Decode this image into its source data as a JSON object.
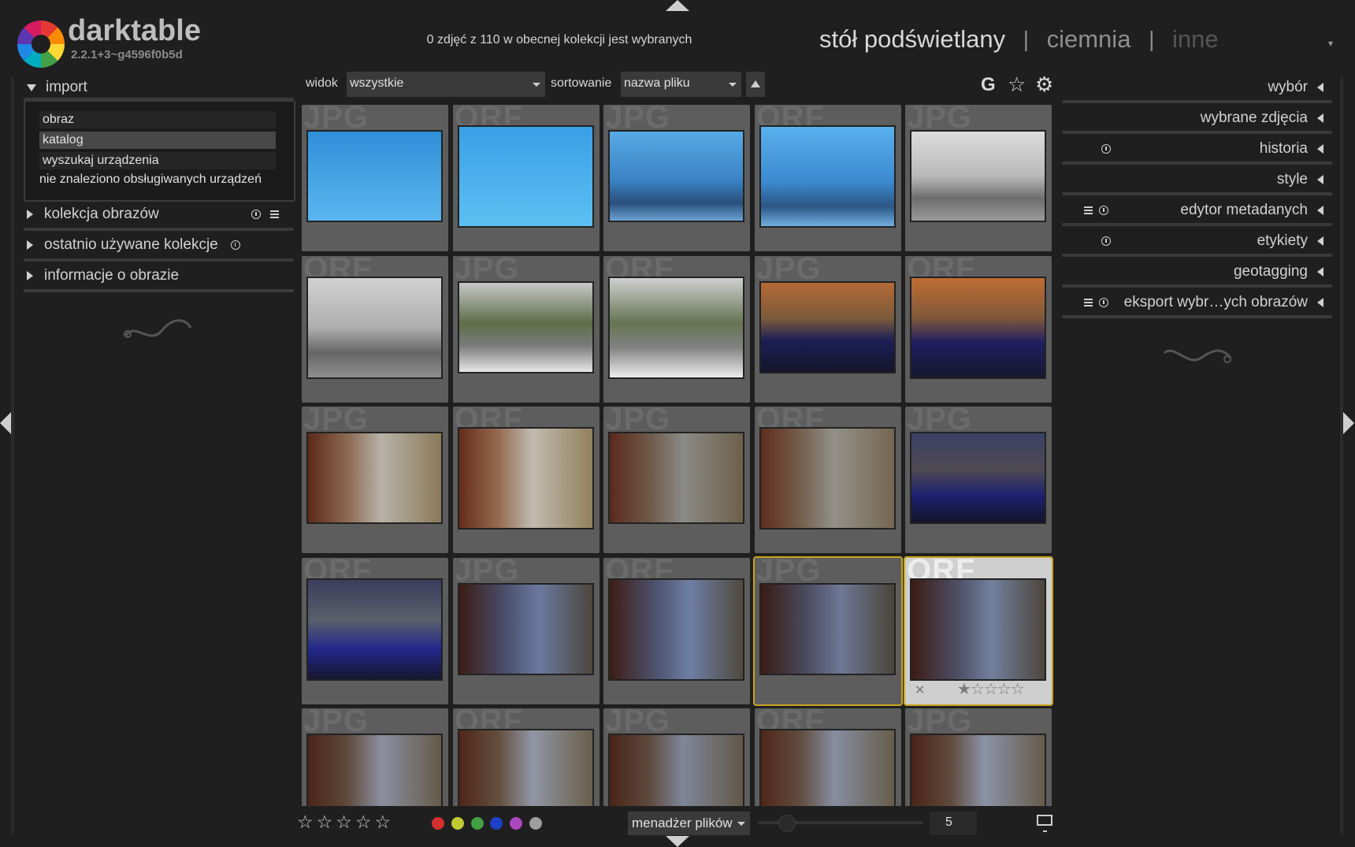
{
  "app": {
    "name": "darktable",
    "version": "2.2.1+3~g4596f0b5d"
  },
  "header": {
    "selection_status": "0 zdjęć z 110 w obecnej kolekcji jest wybranych",
    "views": {
      "active": "stół podświetlany",
      "darkroom": "ciemnia",
      "other": "inne",
      "sep": "|"
    }
  },
  "left_panel": {
    "import": {
      "label": "import",
      "items": [
        "obraz",
        "katalog",
        "wyszukaj urządzenia",
        "nie znaleziono obsługiwanych urządzeń"
      ]
    },
    "modules": [
      "kolekcja obrazów",
      "ostatnio używane kolekcje",
      "informacje o obrazie"
    ]
  },
  "toolbar": {
    "view_label": "widok",
    "view_value": "wszystkie",
    "sort_label": "sortowanie",
    "sort_value": "nazwa pliku",
    "grouping_label": "G",
    "star_glyph": "☆",
    "gear_glyph": "⚙"
  },
  "grid": {
    "thumbnails": [
      {
        "ext": "JPG",
        "palette": "blue-tower-a"
      },
      {
        "ext": "ORF",
        "palette": "blue-tower-b"
      },
      {
        "ext": "JPG",
        "palette": "blue-building-a"
      },
      {
        "ext": "ORF",
        "palette": "blue-building-b"
      },
      {
        "ext": "JPG",
        "palette": "flags-a"
      },
      {
        "ext": "ORF",
        "palette": "flags-b"
      },
      {
        "ext": "JPG",
        "palette": "atrium-a"
      },
      {
        "ext": "ORF",
        "palette": "atrium-b"
      },
      {
        "ext": "JPG",
        "palette": "booth-a"
      },
      {
        "ext": "ORF",
        "palette": "booth-b"
      },
      {
        "ext": "JPG",
        "palette": "hall-a"
      },
      {
        "ext": "ORF",
        "palette": "hall-b"
      },
      {
        "ext": "JPG",
        "palette": "hall-c"
      },
      {
        "ext": "ORF",
        "palette": "hall-d"
      },
      {
        "ext": "JPG",
        "palette": "booth-c"
      },
      {
        "ext": "ORF",
        "palette": "booth-d"
      },
      {
        "ext": "JPG",
        "palette": "slide-a"
      },
      {
        "ext": "ORF",
        "palette": "slide-b"
      },
      {
        "ext": "JPG",
        "palette": "slide-c"
      },
      {
        "ext": "ORF",
        "palette": "slide-d"
      },
      {
        "ext": "JPG",
        "palette": "hall-e"
      },
      {
        "ext": "ORF",
        "palette": "hall-f"
      },
      {
        "ext": "JPG",
        "palette": "hall-g"
      },
      {
        "ext": "ORF",
        "palette": "hall-h"
      },
      {
        "ext": "JPG",
        "palette": "hall-i"
      }
    ],
    "hover_rating": {
      "reject": "✕",
      "stars": "★☆☆☆☆"
    }
  },
  "right_panel": {
    "modules": [
      "wybór",
      "wybrane zdjęcia",
      "historia",
      "style",
      "edytor metadanych",
      "etykiety",
      "geotagging",
      "eksport wybr…ych obrazów"
    ]
  },
  "bottom_bar": {
    "rating_stars": "☆☆☆☆☆",
    "color_labels": [
      "#d32f2f",
      "#c0ca33",
      "#43a047",
      "#1e40c8",
      "#ab47bc",
      "#9e9e9e"
    ],
    "layout_select": "menadżer plików",
    "zoom_level": "5"
  }
}
